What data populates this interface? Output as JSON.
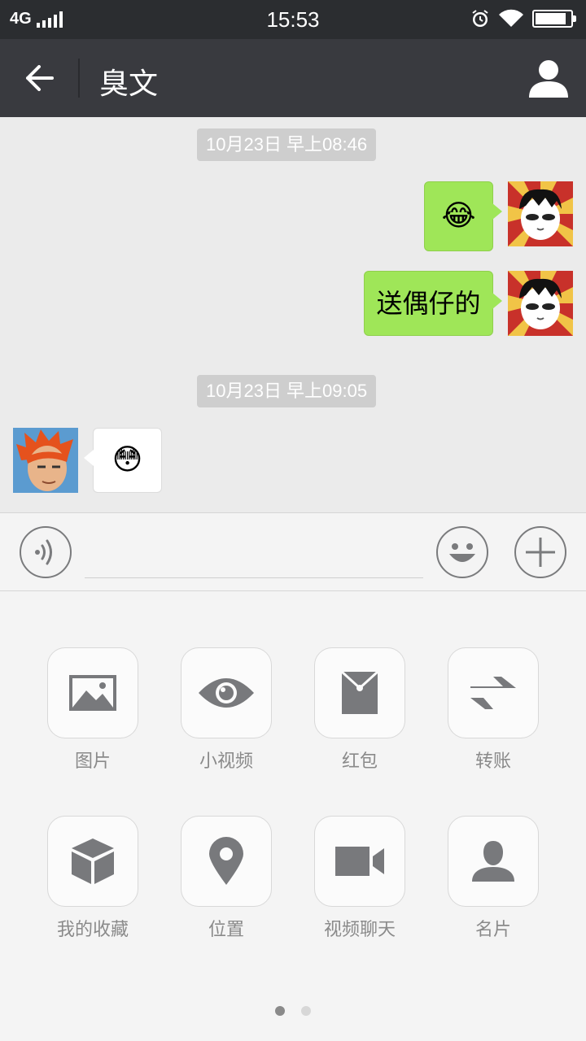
{
  "status_bar": {
    "network": "4G",
    "time": "15:53",
    "battery_level": 0.88
  },
  "header": {
    "title": "臭文",
    "back_icon": "arrow-left-icon",
    "profile_icon": "person-icon"
  },
  "chat": {
    "timestamps": [
      "10月23日 早上08:46",
      "10月23日 早上09:05"
    ],
    "messages": [
      {
        "side": "right",
        "type": "emoji",
        "content": "😂"
      },
      {
        "side": "right",
        "type": "text",
        "content": "送偶仔的"
      },
      {
        "side": "left",
        "type": "emoji",
        "content": "😳"
      }
    ]
  },
  "input_bar": {
    "voice_icon": "voice-icon",
    "emoji_icon": "smiley-icon",
    "plus_icon": "plus-icon"
  },
  "panel": {
    "tools": [
      {
        "label": "图片",
        "icon": "image-icon"
      },
      {
        "label": "小视频",
        "icon": "eye-icon"
      },
      {
        "label": "红包",
        "icon": "red-envelope-icon"
      },
      {
        "label": "转账",
        "icon": "transfer-icon"
      },
      {
        "label": "我的收藏",
        "icon": "cube-icon"
      },
      {
        "label": "位置",
        "icon": "location-pin-icon"
      },
      {
        "label": "视频聊天",
        "icon": "video-camera-icon"
      },
      {
        "label": "名片",
        "icon": "contact-card-icon"
      }
    ],
    "page": 1,
    "page_count": 2
  },
  "colors": {
    "accent": "#9fe658",
    "header_bg": "#393a3f",
    "status_bg": "#2b2d30",
    "icon_gray": "#78797c"
  }
}
